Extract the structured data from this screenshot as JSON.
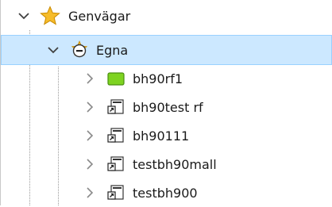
{
  "tree": {
    "root": {
      "label": "Genvägar",
      "icon": "star-icon",
      "expanded": true
    },
    "group": {
      "label": "Egna",
      "icon": "shortcut-folder-icon",
      "expanded": true,
      "selected": true
    },
    "items": [
      {
        "label": "bh90rf1",
        "icon": "green-folder-icon"
      },
      {
        "label": "bh90test rf",
        "icon": "shortcut-icon"
      },
      {
        "label": "bh90111",
        "icon": "shortcut-icon"
      },
      {
        "label": "testbh90mall",
        "icon": "shortcut-icon"
      },
      {
        "label": "testbh900",
        "icon": "shortcut-icon"
      }
    ]
  },
  "colors": {
    "selection": "#cce8ff",
    "selection_border": "#99d1ff",
    "star": "#f4b400",
    "green_folder": "#7ed321"
  }
}
